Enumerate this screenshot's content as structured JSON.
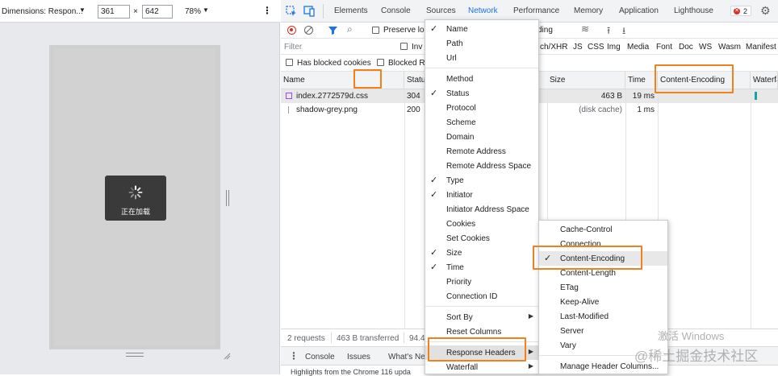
{
  "emulation": {
    "dimensions_label": "Dimensions: Respon...",
    "width": "361",
    "times": "×",
    "height": "642",
    "zoom": "78%",
    "loading_text": "正在加载"
  },
  "devtools": {
    "tabs": [
      "Elements",
      "Console",
      "Sources",
      "Network",
      "Performance",
      "Memory",
      "Application",
      "Lighthouse"
    ],
    "error_count": "2",
    "preserve_log_label": "Preserve lo",
    "throttle_fragment": "ding",
    "filter_placeholder": "Filter",
    "invert_fragment": "Inv",
    "type_filters": [
      "ch/XHR",
      "JS",
      "CSS",
      "Img",
      "Media",
      "Font",
      "Doc",
      "WS",
      "Wasm",
      "Manifest"
    ],
    "blocked_cookies_label": "Has blocked cookies",
    "blocked_req_fragment": "Blocked R",
    "columns": {
      "name": "Name",
      "status": "Statu",
      "size": "Size",
      "time": "Time",
      "content_encoding": "Content-Encoding",
      "waterfall": "Waterfa"
    },
    "rows": [
      {
        "name": "index.2772579d.css",
        "status": "304",
        "size": "463 B",
        "time": "19 ms"
      },
      {
        "name": "shadow-grey.png",
        "status": "200",
        "size": "(disk cache)",
        "time": "1 ms"
      }
    ],
    "status_bar": {
      "requests": "2 requests",
      "transferred": "463 B transferred",
      "fragment": "94.4"
    },
    "drawer_tabs": [
      "Console",
      "Issues",
      "What's Ne"
    ],
    "drawer_text": "Highlights from the Chrome 116 upda"
  },
  "column_menu": {
    "items": [
      {
        "label": "Name",
        "checked": true
      },
      {
        "label": "Path",
        "checked": false
      },
      {
        "label": "Url",
        "checked": false
      },
      {
        "label": "Method",
        "checked": false
      },
      {
        "label": "Status",
        "checked": true
      },
      {
        "label": "Protocol",
        "checked": false
      },
      {
        "label": "Scheme",
        "checked": false
      },
      {
        "label": "Domain",
        "checked": false
      },
      {
        "label": "Remote Address",
        "checked": false
      },
      {
        "label": "Remote Address Space",
        "checked": false
      },
      {
        "label": "Type",
        "checked": true
      },
      {
        "label": "Initiator",
        "checked": true
      },
      {
        "label": "Initiator Address Space",
        "checked": false
      },
      {
        "label": "Cookies",
        "checked": false
      },
      {
        "label": "Set Cookies",
        "checked": false
      },
      {
        "label": "Size",
        "checked": true
      },
      {
        "label": "Time",
        "checked": true
      },
      {
        "label": "Priority",
        "checked": false
      },
      {
        "label": "Connection ID",
        "checked": false
      },
      {
        "label": "Sort By",
        "checked": false
      },
      {
        "label": "Reset Columns",
        "checked": false
      },
      {
        "label": "Response Headers",
        "checked": false
      },
      {
        "label": "Waterfall",
        "checked": false
      }
    ]
  },
  "headers_menu": {
    "items": [
      {
        "label": "Cache-Control",
        "checked": false
      },
      {
        "label": "Connection",
        "checked": false
      },
      {
        "label": "Content-Encoding",
        "checked": true
      },
      {
        "label": "Content-Length",
        "checked": false
      },
      {
        "label": "ETag",
        "checked": false
      },
      {
        "label": "Keep-Alive",
        "checked": false
      },
      {
        "label": "Last-Modified",
        "checked": false
      },
      {
        "label": "Server",
        "checked": false
      },
      {
        "label": "Vary",
        "checked": false
      },
      {
        "label": "Manage Header Columns...",
        "checked": false
      }
    ]
  },
  "overlay": {
    "activate_windows": "激活 Windows",
    "watermark": "@稀土掘金技术社区"
  },
  "colors": {
    "highlight": "#f2811d",
    "selected_row": "#e8e8e8",
    "record_red": "#d93025",
    "accent_blue": "#1a73e8"
  }
}
